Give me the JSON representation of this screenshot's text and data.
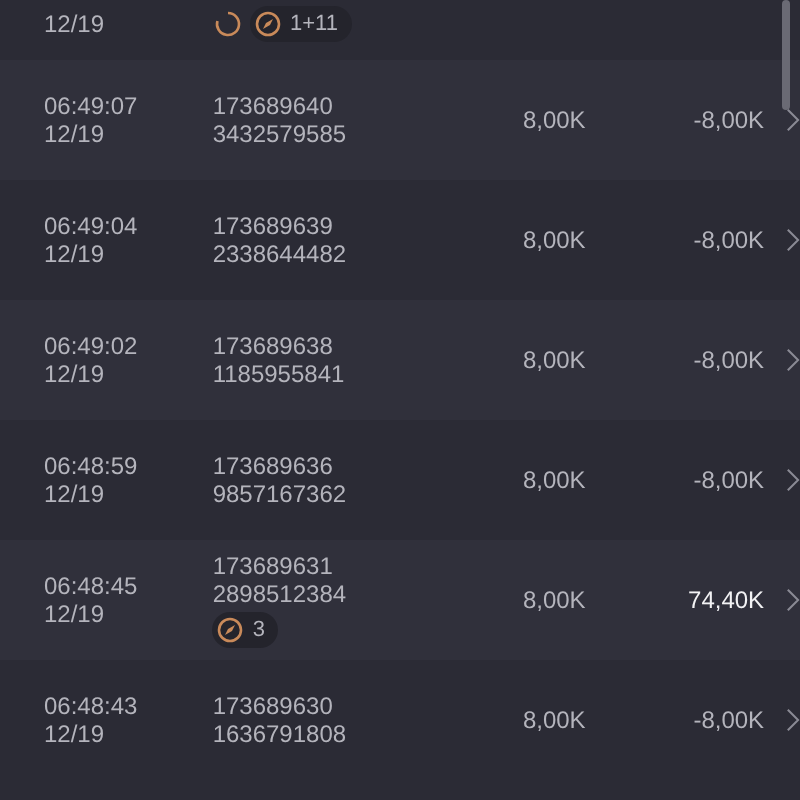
{
  "partial_row": {
    "date": "12/19",
    "loading": true,
    "badge": "1+11"
  },
  "rows": [
    {
      "time": "06:49:07",
      "date": "12/19",
      "id_line_1": "173689640",
      "id_line_2": "3432579585",
      "bet": "8,00K",
      "win": "-8,00K",
      "won": false
    },
    {
      "time": "06:49:04",
      "date": "12/19",
      "id_line_1": "173689639",
      "id_line_2": "2338644482",
      "bet": "8,00K",
      "win": "-8,00K",
      "won": false
    },
    {
      "time": "06:49:02",
      "date": "12/19",
      "id_line_1": "173689638",
      "id_line_2": "1185955841",
      "bet": "8,00K",
      "win": "-8,00K",
      "won": false
    },
    {
      "time": "06:48:59",
      "date": "12/19",
      "id_line_1": "173689636",
      "id_line_2": "9857167362",
      "bet": "8,00K",
      "win": "-8,00K",
      "won": false
    },
    {
      "time": "06:48:45",
      "date": "12/19",
      "id_line_1": "173689631",
      "id_line_2": "2898512384",
      "badge": "3",
      "bet": "8,00K",
      "win": "74,40K",
      "won": true
    },
    {
      "time": "06:48:43",
      "date": "12/19",
      "id_line_1": "173689630",
      "id_line_2": "1636791808",
      "bet": "8,00K",
      "win": "-8,00K",
      "won": false
    }
  ]
}
